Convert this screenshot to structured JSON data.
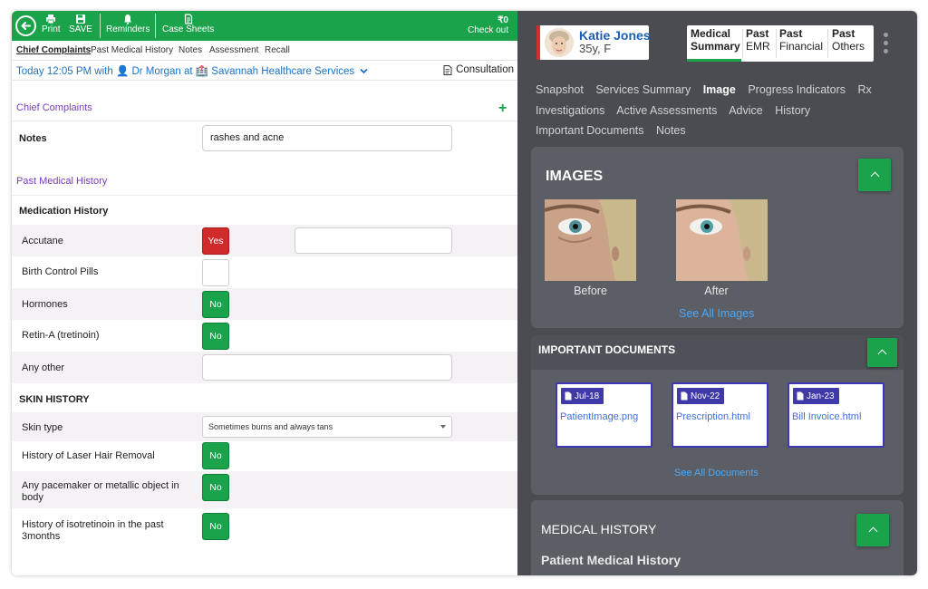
{
  "toolbar": {
    "print_label": "Print",
    "save_label": "SAVE",
    "reminders_label": "Reminders",
    "case_sheets_label": "Case Sheets",
    "checkout_amount": "₹0",
    "checkout_label": "Check out"
  },
  "subtabs": [
    "Chief Complaints",
    "Past Medical History",
    "Notes",
    "Assessment",
    "Recall"
  ],
  "visit": {
    "text": "Today 12:05 PM with 👤 Dr Morgan at 🏥 Savannah Healthcare Services",
    "consultation_label": "Consultation"
  },
  "chief_complaints": {
    "title": "Chief Complaints",
    "add_symbol": "+",
    "notes_label": "Notes",
    "notes_value": "rashes and acne"
  },
  "past_medical_history": {
    "title": "Past Medical History",
    "medication_history_label": "Medication History",
    "medications": [
      {
        "label": "Accutane",
        "value": "Yes"
      },
      {
        "label": "Birth Control Pills",
        "value": ""
      },
      {
        "label": "Hormones",
        "value": "No"
      },
      {
        "label": "Retin-A (tretinoin)",
        "value": "No"
      },
      {
        "label": "Any other",
        "value": ""
      }
    ]
  },
  "skin_history": {
    "title": "SKIN HISTORY",
    "skin_type_label": "Skin type",
    "skin_type_value": "Sometimes burns and always tans",
    "items": [
      {
        "label": "History of Laser Hair Removal",
        "value": "No"
      },
      {
        "label": "Any pacemaker or metallic object in body",
        "value": "No"
      },
      {
        "label": "History of isotretinoin in the past 3months",
        "value": "No"
      }
    ]
  },
  "patient": {
    "name": "Katie Jones",
    "info": "35y, F"
  },
  "summary_tabs": [
    {
      "line1": "Medical",
      "line2": "Summary"
    },
    {
      "line1": "Past",
      "line2": "EMR"
    },
    {
      "line1": "Past",
      "line2": "Financial"
    },
    {
      "line1": "Past",
      "line2": "Others"
    }
  ],
  "nav": {
    "items": [
      "Snapshot",
      "Services Summary",
      "Image",
      "Progress Indicators",
      "Rx",
      "Investigations",
      "Active Assessments",
      "Advice",
      "History",
      "Important Documents",
      "Notes"
    ],
    "active": "Image"
  },
  "images_card": {
    "title": "IMAGES",
    "before_label": "Before",
    "after_label": "After",
    "see_all": "See All Images"
  },
  "documents_card": {
    "title": "IMPORTANT DOCUMENTS",
    "documents": [
      {
        "date": "Jul-18",
        "name": "PatientImage.png"
      },
      {
        "date": "Nov-22",
        "name": "Prescription.html"
      },
      {
        "date": "Jan-23",
        "name": "Bill Invoice.html"
      }
    ],
    "see_all": "See All Documents"
  },
  "medical_history_card": {
    "title": "MEDICAL HISTORY",
    "subtitle": "Patient Medical History"
  },
  "colors": {
    "brand_green": "#1aa34a",
    "yes_red": "#d12a2a",
    "panel_dark": "#4a4c52",
    "card_dark": "#5b5e64",
    "link_blue": "#4ea8f5",
    "section_purple": "#7a3cc2"
  }
}
